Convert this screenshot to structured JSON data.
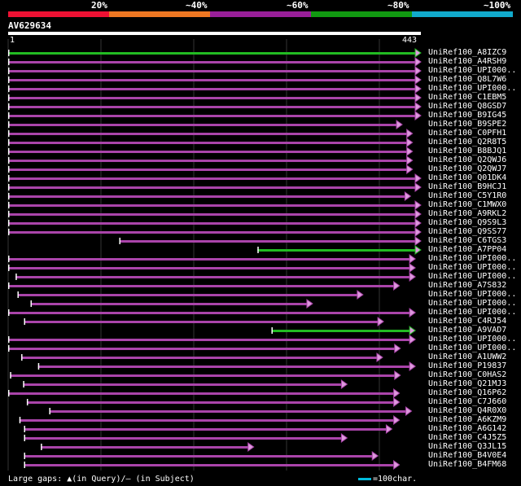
{
  "legend": [
    {
      "label": "20%",
      "color": "#ee1133"
    },
    {
      "label": "~40%",
      "color": "#ee7722"
    },
    {
      "label": "~60%",
      "color": "#991f99"
    },
    {
      "label": "~80%",
      "color": "#119911"
    },
    {
      "label": "~100%",
      "color": "#11aacc"
    }
  ],
  "query": {
    "name": "AV629634",
    "start": "1",
    "end": "443"
  },
  "hits": [
    {
      "name": "UniRef100_A8IZC9",
      "color": "green",
      "start": 1,
      "end": 443
    },
    {
      "name": "UniRef100_A4RSH9",
      "color": "purple",
      "start": 1,
      "end": 443
    },
    {
      "name": "UniRef100_UPI000..",
      "color": "purple",
      "start": 1,
      "end": 443
    },
    {
      "name": "UniRef100_Q8L7W6",
      "color": "purple",
      "start": 1,
      "end": 443
    },
    {
      "name": "UniRef100_UPI000..",
      "color": "purple",
      "start": 1,
      "end": 443
    },
    {
      "name": "UniRef100_C1EBM5",
      "color": "purple",
      "start": 1,
      "end": 443
    },
    {
      "name": "UniRef100_Q8GSD7",
      "color": "purple",
      "start": 1,
      "end": 443
    },
    {
      "name": "UniRef100_B9IG45",
      "color": "purple",
      "start": 1,
      "end": 443
    },
    {
      "name": "UniRef100_B9SPE2",
      "color": "purple",
      "start": 1,
      "end": 423
    },
    {
      "name": "UniRef100_C0PFH1",
      "color": "purple",
      "start": 1,
      "end": 434
    },
    {
      "name": "UniRef100_Q2R8T5",
      "color": "purple",
      "start": 1,
      "end": 434
    },
    {
      "name": "UniRef100_B8BJQ1",
      "color": "purple",
      "start": 1,
      "end": 434
    },
    {
      "name": "UniRef100_Q2QWJ6",
      "color": "purple",
      "start": 1,
      "end": 434
    },
    {
      "name": "UniRef100_Q2QWJ7",
      "color": "purple",
      "start": 1,
      "end": 434
    },
    {
      "name": "UniRef100_Q01DK4",
      "color": "purple",
      "start": 1,
      "end": 443
    },
    {
      "name": "UniRef100_B9HCJ1",
      "color": "purple",
      "start": 1,
      "end": 443
    },
    {
      "name": "UniRef100_C5Y1R0",
      "color": "purple",
      "start": 1,
      "end": 432
    },
    {
      "name": "UniRef100_C1MWX0",
      "color": "purple",
      "start": 1,
      "end": 443
    },
    {
      "name": "UniRef100_A9RKL2",
      "color": "purple",
      "start": 1,
      "end": 443
    },
    {
      "name": "UniRef100_Q9S9L3",
      "color": "purple",
      "start": 1,
      "end": 443
    },
    {
      "name": "UniRef100_Q9SS77",
      "color": "purple",
      "start": 1,
      "end": 443
    },
    {
      "name": "UniRef100_C6TGS3",
      "color": "purple",
      "start": 120,
      "end": 443
    },
    {
      "name": "UniRef100_A7PP04",
      "color": "green",
      "start": 268,
      "end": 443
    },
    {
      "name": "UniRef100_UPI000..",
      "color": "purple",
      "start": 1,
      "end": 437
    },
    {
      "name": "UniRef100_UPI000..",
      "color": "purple",
      "start": 1,
      "end": 437
    },
    {
      "name": "UniRef100_UPI000..",
      "color": "purple",
      "start": 9,
      "end": 437
    },
    {
      "name": "UniRef100_A7S832",
      "color": "purple",
      "start": 1,
      "end": 420
    },
    {
      "name": "UniRef100_UPI000..",
      "color": "purple",
      "start": 11,
      "end": 381
    },
    {
      "name": "UniRef100_UPI000..",
      "color": "purple",
      "start": 25,
      "end": 327
    },
    {
      "name": "UniRef100_UPI000..",
      "color": "purple",
      "start": 1,
      "end": 437
    },
    {
      "name": "UniRef100_C4RJ54",
      "color": "purple",
      "start": 18,
      "end": 403
    },
    {
      "name": "UniRef100_A9VAD7",
      "color": "green",
      "start": 283,
      "end": 437
    },
    {
      "name": "UniRef100_UPI000..",
      "color": "purple",
      "start": 1,
      "end": 437
    },
    {
      "name": "UniRef100_UPI000..",
      "color": "purple",
      "start": 1,
      "end": 421
    },
    {
      "name": "UniRef100_A1UWW2",
      "color": "purple",
      "start": 15,
      "end": 402
    },
    {
      "name": "UniRef100_P19837",
      "color": "purple",
      "start": 33,
      "end": 437
    },
    {
      "name": "UniRef100_C0HAS2",
      "color": "purple",
      "start": 3,
      "end": 421
    },
    {
      "name": "UniRef100_Q21MJ3",
      "color": "purple",
      "start": 17,
      "end": 364
    },
    {
      "name": "UniRef100_Q16P62",
      "color": "purple",
      "start": 1,
      "end": 420
    },
    {
      "name": "UniRef100_C7J660",
      "color": "purple",
      "start": 21,
      "end": 420
    },
    {
      "name": "UniRef100_Q4R0X0",
      "color": "purple",
      "start": 45,
      "end": 433
    },
    {
      "name": "UniRef100_A6KZM9",
      "color": "purple",
      "start": 13,
      "end": 420
    },
    {
      "name": "UniRef100_A6G142",
      "color": "purple",
      "start": 18,
      "end": 412
    },
    {
      "name": "UniRef100_C4J5Z5",
      "color": "purple",
      "start": 18,
      "end": 364
    },
    {
      "name": "UniRef100_Q3JL15",
      "color": "purple",
      "start": 36,
      "end": 264
    },
    {
      "name": "UniRef100_B4V0E4",
      "color": "purple",
      "start": 18,
      "end": 397
    },
    {
      "name": "UniRef100_B4FM68",
      "color": "purple",
      "start": 18,
      "end": 420
    }
  ],
  "footer": {
    "gaps_text": "Large gaps: ▲(in Query)/– (in Subject)",
    "scale_text": "=100char."
  }
}
